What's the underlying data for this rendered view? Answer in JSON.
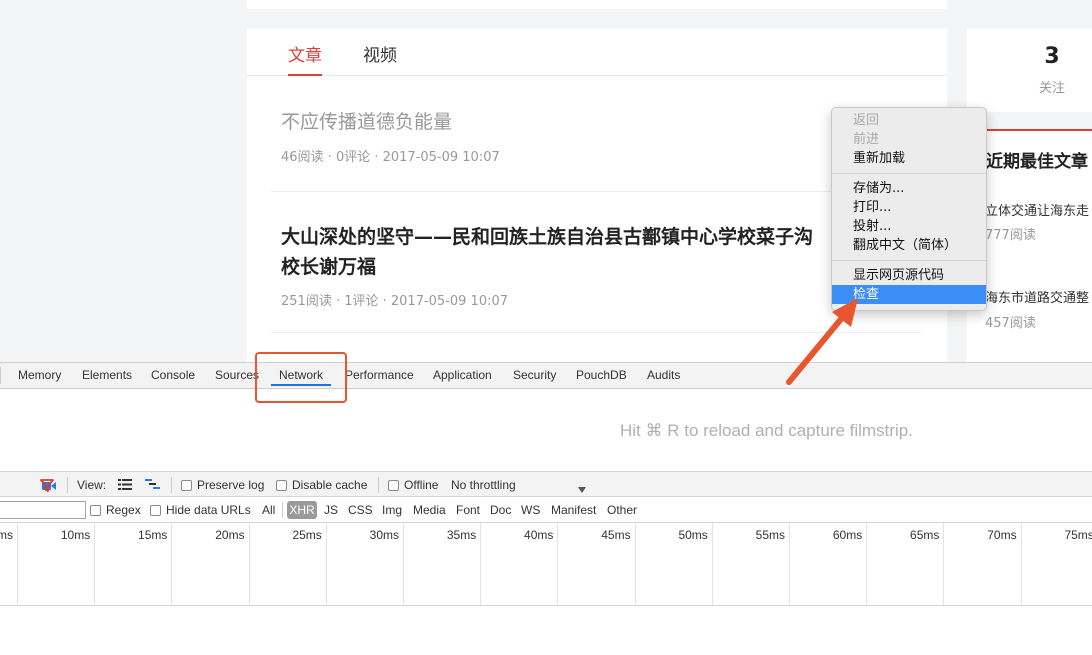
{
  "page": {
    "tabs": [
      {
        "label": "文章"
      },
      {
        "label": "视频"
      }
    ],
    "articles": [
      {
        "title": "不应传播道德负能量",
        "meta": "46阅读 · 0评论 · 2017-05-09 10:07"
      },
      {
        "title_line1": "大山深处的坚守——民和回族土族自治县古鄯镇中心学校菜子沟",
        "title_line2": "校长谢万福",
        "meta": "251阅读 · 1评论 · 2017-05-09 10:07"
      }
    ],
    "follow": {
      "count": "3",
      "label": "关注"
    },
    "best": {
      "title": "近期最佳文章",
      "items": [
        {
          "title": "立体交通让海东走",
          "reads": "777阅读"
        },
        {
          "title": "海东市道路交通整",
          "reads": "457阅读"
        }
      ]
    }
  },
  "context_menu": {
    "group1": [
      "返回",
      "前进",
      "重新加载"
    ],
    "group2": [
      "存储为...",
      "打印...",
      "投射...",
      "翻成中文（简体）"
    ],
    "group3": [
      "显示网页源代码",
      "检查"
    ]
  },
  "devtools": {
    "tabs": [
      "Memory",
      "Elements",
      "Console",
      "Sources",
      "Network",
      "Performance",
      "Application",
      "Security",
      "PouchDB",
      "Audits"
    ],
    "selected_tab": "Network",
    "hint": "Hit ⌘ R to reload and capture filmstrip.",
    "toolbar": {
      "view_label": "View:",
      "preserve_log": "Preserve log",
      "disable_cache": "Disable cache",
      "offline": "Offline",
      "throttling": "No throttling"
    },
    "filter": {
      "regex": "Regex",
      "hide_data_urls": "Hide data URLs",
      "types": [
        "All",
        "XHR",
        "JS",
        "CSS",
        "Img",
        "Media",
        "Font",
        "Doc",
        "WS",
        "Manifest",
        "Other"
      ]
    },
    "ticks": [
      "ms",
      "10ms",
      "15ms",
      "20ms",
      "25ms",
      "30ms",
      "35ms",
      "40ms",
      "45ms",
      "50ms",
      "55ms",
      "60ms",
      "65ms",
      "70ms",
      "75ms"
    ]
  },
  "colors": {
    "accent": "#e23c35",
    "highlight": "#3c8ef7",
    "annotation": "#e8552e"
  },
  "icons": [
    "record-icon",
    "filter-icon",
    "list-view-icon",
    "waterfall-view-icon",
    "dropdown-arrow-icon",
    "arrow-annotation"
  ]
}
